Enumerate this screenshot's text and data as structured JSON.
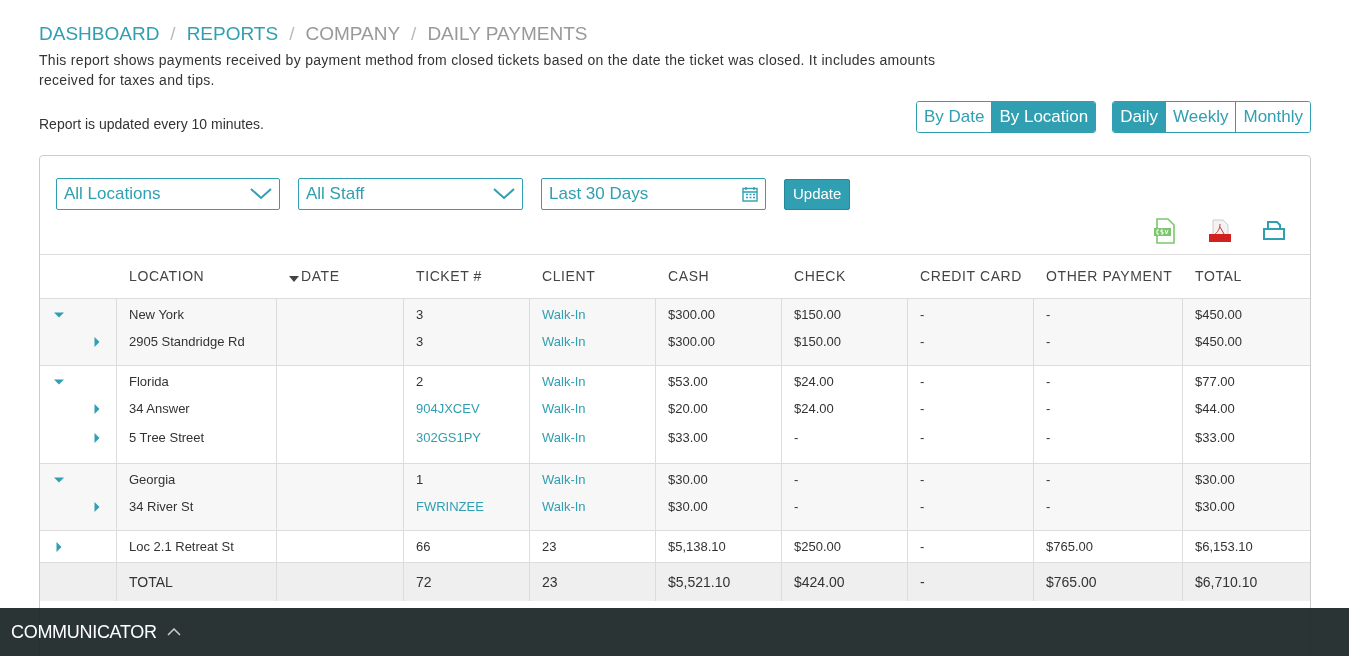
{
  "breadcrumb": [
    {
      "label": "DASHBOARD",
      "link": true
    },
    {
      "label": "REPORTS",
      "link": true
    },
    {
      "label": "COMPANY",
      "link": false
    },
    {
      "label": "DAILY PAYMENTS",
      "link": false
    }
  ],
  "breadcrumb_separator": "/",
  "description": "This report shows payments received by payment method from closed tickets based on the date the ticket was closed. It includes amounts received for taxes and tips.",
  "update_note": "Report is updated every 10 minutes.",
  "view_toggle": [
    {
      "label": "By Date",
      "selected": false
    },
    {
      "label": "By Location",
      "selected": true
    }
  ],
  "period_toggle": [
    {
      "label": "Daily",
      "selected": true
    },
    {
      "label": "Weekly",
      "selected": false
    },
    {
      "label": "Monthly",
      "selected": false
    }
  ],
  "filters": {
    "location": "All Locations",
    "staff": "All Staff",
    "date_range": "Last 30 Days",
    "button": "Update"
  },
  "columns": [
    {
      "label": "LOCATION",
      "sorted": false
    },
    {
      "label": "DATE",
      "sorted": true
    },
    {
      "label": "TICKET #",
      "sorted": false
    },
    {
      "label": "CLIENT",
      "sorted": false
    },
    {
      "label": "CASH",
      "sorted": false
    },
    {
      "label": "CHECK",
      "sorted": false
    },
    {
      "label": "CREDIT CARD",
      "sorted": false
    },
    {
      "label": "OTHER PAYMENT",
      "sorted": false
    },
    {
      "label": "TOTAL",
      "sorted": false
    }
  ],
  "groups": [
    {
      "location": "New York",
      "ticket": "3",
      "ticket_link": false,
      "client": "Walk-In",
      "client_link": true,
      "cash": "$300.00",
      "check": "$150.00",
      "credit_card": "-",
      "other": "-",
      "total": "$450.00",
      "expanded": true,
      "children": [
        {
          "location": "2905 Standridge Rd",
          "ticket": "3",
          "ticket_link": false,
          "client": "Walk-In",
          "client_link": true,
          "cash": "$300.00",
          "check": "$150.00",
          "credit_card": "-",
          "other": "-",
          "total": "$450.00",
          "expanded": false
        }
      ]
    },
    {
      "location": "Florida",
      "ticket": "2",
      "ticket_link": false,
      "client": "Walk-In",
      "client_link": true,
      "cash": "$53.00",
      "check": "$24.00",
      "credit_card": "-",
      "other": "-",
      "total": "$77.00",
      "expanded": true,
      "children": [
        {
          "location": "34 Answer",
          "ticket": "904JXCEV",
          "ticket_link": true,
          "client": "Walk-In",
          "client_link": true,
          "cash": "$20.00",
          "check": "$24.00",
          "credit_card": "-",
          "other": "-",
          "total": "$44.00",
          "expanded": false
        },
        {
          "location": "5 Tree Street",
          "ticket": "302GS1PY",
          "ticket_link": true,
          "client": "Walk-In",
          "client_link": true,
          "cash": "$33.00",
          "check": "-",
          "credit_card": "-",
          "other": "-",
          "total": "$33.00",
          "expanded": false
        }
      ]
    },
    {
      "location": "Georgia",
      "ticket": "1",
      "ticket_link": false,
      "client": "Walk-In",
      "client_link": true,
      "cash": "$30.00",
      "check": "-",
      "credit_card": "-",
      "other": "-",
      "total": "$30.00",
      "expanded": true,
      "children": [
        {
          "location": "34 River St",
          "ticket": "FWRINZEE",
          "ticket_link": true,
          "client": "Walk-In",
          "client_link": true,
          "cash": "$30.00",
          "check": "-",
          "credit_card": "-",
          "other": "-",
          "total": "$30.00",
          "expanded": false
        }
      ]
    },
    {
      "location": "Loc 2.1 Retreat St",
      "ticket": "66",
      "ticket_link": false,
      "client": "23",
      "client_link": false,
      "cash": "$5,138.10",
      "check": "$250.00",
      "credit_card": "-",
      "other": "$765.00",
      "total": "$6,153.10",
      "expanded": false
    }
  ],
  "total_row": {
    "location": "TOTAL",
    "ticket": "72",
    "client": "23",
    "cash": "$5,521.10",
    "check": "$424.00",
    "credit_card": "-",
    "other": "$765.00",
    "total": "$6,710.10"
  },
  "communicator": {
    "label": "COMMUNICATOR",
    "expanded": false
  }
}
